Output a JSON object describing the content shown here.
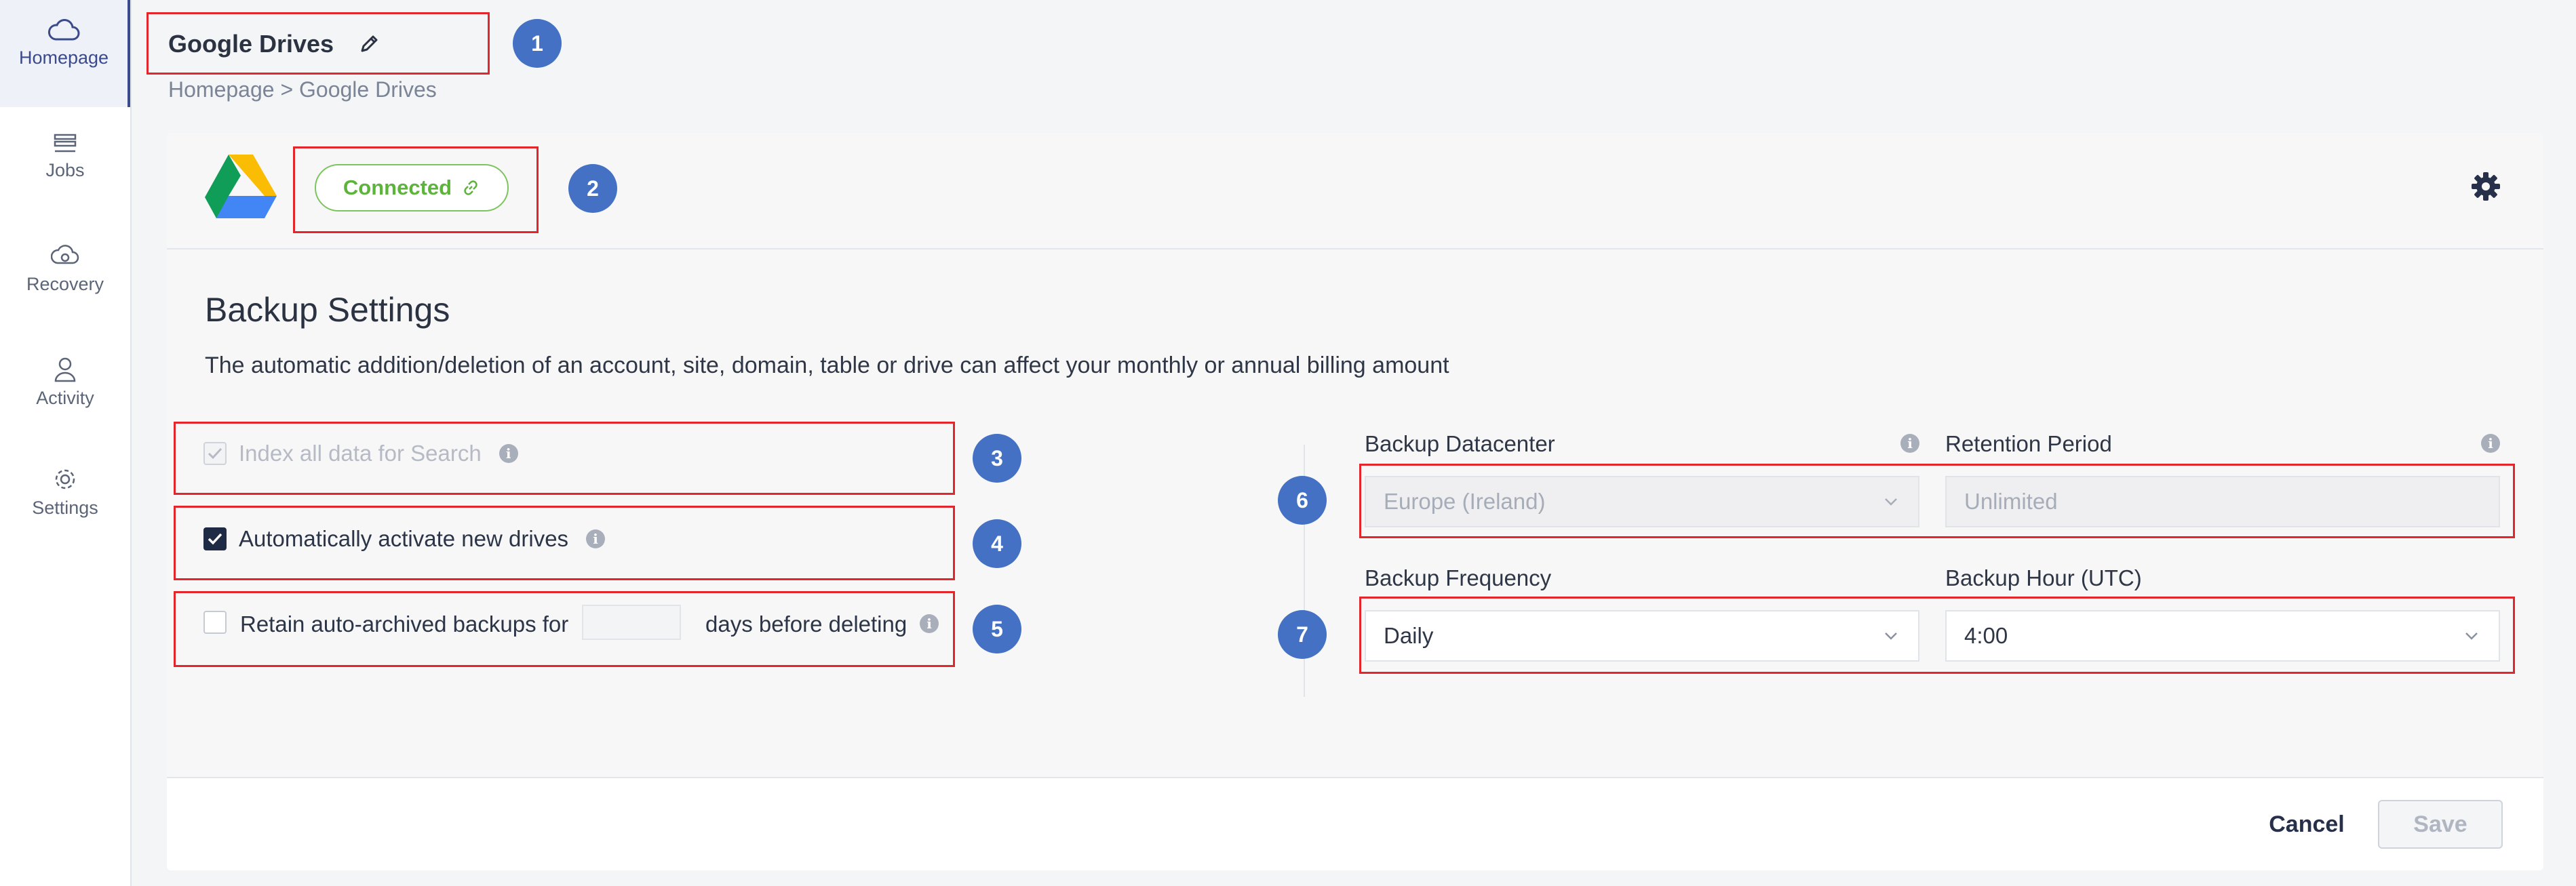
{
  "sidebar": {
    "items": [
      {
        "label": "Homepage",
        "icon": "cloud-icon",
        "active": true
      },
      {
        "label": "Jobs",
        "icon": "stack-icon"
      },
      {
        "label": "Recovery",
        "icon": "cloud-refresh-icon"
      },
      {
        "label": "Activity",
        "icon": "user-icon"
      },
      {
        "label": "Settings",
        "icon": "gear-icon"
      }
    ]
  },
  "header": {
    "title": "Google Drives",
    "breadcrumb": "Homepage > Google Drives"
  },
  "card": {
    "status_label": "Connected",
    "section_title": "Backup Settings",
    "description": "The automatic addition/deletion of an account, site, domain, table or drive can affect your monthly or annual billing amount",
    "options": {
      "index_label": "Index all data for Search",
      "auto_activate_label": "Automatically activate new drives",
      "retain_label": "Retain auto-archived backups for",
      "retain_suffix": "days before deleting"
    },
    "fields": {
      "datacenter_label": "Backup Datacenter",
      "datacenter_value": "Europe (Ireland)",
      "retention_label": "Retention Period",
      "retention_placeholder": "Unlimited",
      "frequency_label": "Backup Frequency",
      "frequency_value": "Daily",
      "hour_label": "Backup Hour (UTC)",
      "hour_value": "4:00"
    },
    "footer": {
      "cancel_label": "Cancel",
      "save_label": "Save"
    }
  },
  "annotations": [
    "1",
    "2",
    "3",
    "4",
    "5",
    "6",
    "7"
  ],
  "colors": {
    "highlight_box": "#e3262c",
    "badge": "#4471c4",
    "connected": "#5cb43b"
  }
}
